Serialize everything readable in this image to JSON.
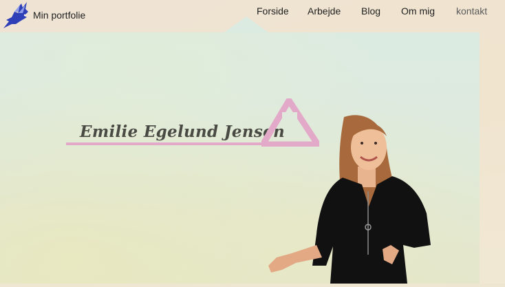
{
  "header": {
    "brand": "Min portfolie",
    "nav": [
      "Forside",
      "Arbejde",
      "Blog",
      "Om mig",
      "kontakt"
    ]
  },
  "hero": {
    "name": "Emilie Egelund Jensen"
  },
  "colors": {
    "accent": "#e2a9c8",
    "panel": "#dcebe2",
    "text": "#1e1e1e",
    "bird": "#2e3fb8"
  },
  "icons": {
    "logo": "bird-icon",
    "mark": "triangle-icon"
  }
}
